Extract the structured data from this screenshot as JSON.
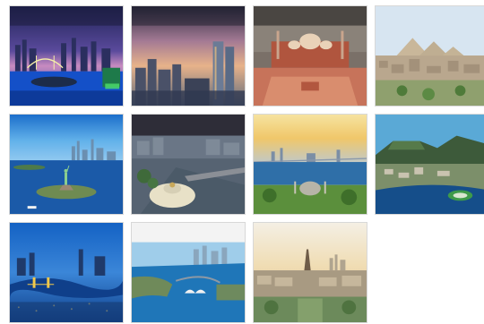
{
  "tiles": [
    {
      "id": "tokyo-skyline",
      "title": "",
      "text": "",
      "colors": {
        "sky": "#3a4a8f",
        "water": "#1b4fbf",
        "accent": "#ffe45a"
      }
    },
    {
      "id": "city-towers-dusk",
      "title": "",
      "text": "",
      "colors": {
        "sky": "#b98a9c",
        "water": "#3a4b6a",
        "accent": "#f1c27c"
      }
    },
    {
      "id": "mosque-courtyard",
      "title": "",
      "text": "",
      "colors": {
        "sky": "#6f6a64",
        "ground": "#c7735a",
        "accent": "#e9d2b8"
      }
    },
    {
      "id": "pyramids-city",
      "title": "",
      "text": "",
      "colors": {
        "sky": "#cfe0f0",
        "ground": "#b7a58d",
        "accent": "#d9c9a6"
      }
    },
    {
      "id": "statue-of-liberty",
      "title": "",
      "text": "",
      "colors": {
        "sky": "#2c8ad9",
        "water": "#1b5aa8",
        "accent": "#8bcf8f"
      }
    },
    {
      "id": "palace-aerial",
      "title": "",
      "text": "",
      "colors": {
        "sky": "#3d3c4a",
        "ground": "#6b7a8a",
        "accent": "#e8e1c7"
      }
    },
    {
      "id": "istanbul-bosphorus",
      "title": "",
      "text": "",
      "colors": {
        "sky": "#f3d37a",
        "water": "#2f6fa8",
        "accent": "#5b8f3c"
      }
    },
    {
      "id": "cape-town-mountain",
      "title": "",
      "text": "",
      "colors": {
        "sky": "#5fb0d9",
        "water": "#154e8a",
        "accent": "#3d6b2f"
      }
    },
    {
      "id": "london-thames-night",
      "title": "",
      "text": "",
      "colors": {
        "sky": "#1d6fc6",
        "water": "#0f3f8a",
        "accent": "#f2c94a"
      }
    },
    {
      "id": "sydney-harbour",
      "title": "",
      "text": "",
      "colors": {
        "sky": "#9fcdea",
        "water": "#1f76b8",
        "accent": "#e8e8e8"
      }
    },
    {
      "id": "paris-eiffel",
      "title": "",
      "text": "",
      "colors": {
        "sky": "#f1e3c6",
        "ground": "#6c8a5b",
        "accent": "#7d6a54"
      }
    }
  ]
}
